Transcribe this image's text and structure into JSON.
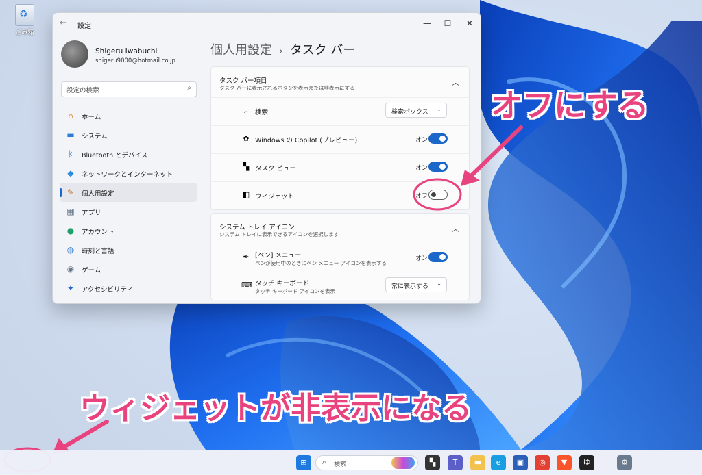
{
  "desktop": {
    "recycle_bin_label": "ごみ箱"
  },
  "window": {
    "title": "設定",
    "back_icon": "←",
    "minimize_icon": "—",
    "maximize_icon": "☐",
    "close_icon": "✕"
  },
  "profile": {
    "name": "Shigeru Iwabuchi",
    "email": "shigeru9000@hotmail.co.jp"
  },
  "search": {
    "placeholder": "設定の検索",
    "icon": "⌕"
  },
  "sidebar": {
    "items": [
      {
        "label": "ホーム",
        "icon": "home-icon",
        "glyph": "⌂",
        "color": "#d98b2b"
      },
      {
        "label": "システム",
        "icon": "system-icon",
        "glyph": "▬",
        "color": "#2a7fd4"
      },
      {
        "label": "Bluetooth とデバイス",
        "icon": "bluetooth-icon",
        "glyph": "ᛒ",
        "color": "#1a66c9"
      },
      {
        "label": "ネットワークとインターネット",
        "icon": "wifi-icon",
        "glyph": "◆",
        "color": "#2b8de0"
      },
      {
        "label": "個人用設定",
        "icon": "brush-icon",
        "glyph": "✎",
        "color": "#c2762b",
        "active": true
      },
      {
        "label": "アプリ",
        "icon": "apps-icon",
        "glyph": "▦",
        "color": "#5a6b80"
      },
      {
        "label": "アカウント",
        "icon": "account-icon",
        "glyph": "●",
        "color": "#1fa06b"
      },
      {
        "label": "時刻と言語",
        "icon": "globe-icon",
        "glyph": "◍",
        "color": "#2b78c8"
      },
      {
        "label": "ゲーム",
        "icon": "gamepad-icon",
        "glyph": "◉",
        "color": "#6b7a8c"
      },
      {
        "label": "アクセシビリティ",
        "icon": "accessibility-icon",
        "glyph": "✦",
        "color": "#1a66c9"
      }
    ]
  },
  "breadcrumb": {
    "parent": "個人用設定",
    "separator": "›",
    "current": "タスク バー"
  },
  "taskbar_items_group": {
    "title": "タスク バー項目",
    "subtitle": "タスク バーに表示されるボタンを表示または非表示にする",
    "chevron": "︿",
    "rows": [
      {
        "label": "検索",
        "icon": "search-icon",
        "glyph": "⌕",
        "control": "dropdown",
        "value": "検索ボックス"
      },
      {
        "label": "Windows の Copilot (プレビュー)",
        "icon": "copilot-icon",
        "glyph": "✿",
        "control": "toggle",
        "state": "オン",
        "on": true
      },
      {
        "label": "タスク ビュー",
        "icon": "task-view-icon",
        "glyph": "▚",
        "control": "toggle",
        "state": "オン",
        "on": true
      },
      {
        "label": "ウィジェット",
        "icon": "widgets-icon",
        "glyph": "◧",
        "control": "toggle",
        "state": "オフ",
        "on": false
      }
    ]
  },
  "tray_group": {
    "title": "システム トレイ アイコン",
    "subtitle": "システム トレイに表示できるアイコンを選択します",
    "chevron": "︿",
    "rows": [
      {
        "label": "[ペン] メニュー",
        "sublabel": "ペンが使用中のときにペン メニュー アイコンを表示する",
        "icon": "pen-icon",
        "glyph": "✒",
        "control": "toggle",
        "state": "オン",
        "on": true
      },
      {
        "label": "タッチ キーボード",
        "sublabel": "タッチ キーボード アイコンを表示",
        "icon": "keyboard-icon",
        "glyph": "⌨",
        "control": "dropdown",
        "value": "常に表示する"
      }
    ]
  },
  "annotations": {
    "off_text": "オフにする",
    "hidden_text": "ウィジェットが非表示になる",
    "color": "#e8437e"
  },
  "taskbar": {
    "search_placeholder": "検索",
    "icons": [
      {
        "name": "start-icon",
        "color": "#1f7ae0",
        "glyph": "⊞"
      },
      {
        "name": "task-view-icon",
        "color": "#333333",
        "glyph": "▚"
      },
      {
        "name": "teams-icon",
        "color": "#5b5fc7",
        "glyph": "T"
      },
      {
        "name": "file-explorer-icon",
        "color": "#f2c14e",
        "glyph": "▬"
      },
      {
        "name": "edge-icon",
        "color": "#1b9de2",
        "glyph": "e"
      },
      {
        "name": "store-icon",
        "color": "#2b5fb8",
        "glyph": "▣"
      },
      {
        "name": "chrome-icon",
        "color": "#e34133",
        "glyph": "◎"
      },
      {
        "name": "brave-icon",
        "color": "#fb542b",
        "glyph": "▼"
      },
      {
        "name": "app-icon",
        "color": "#222222",
        "glyph": "ゆ"
      },
      {
        "name": "settings-icon",
        "color": "#6a7a8e",
        "glyph": "⚙"
      }
    ]
  }
}
